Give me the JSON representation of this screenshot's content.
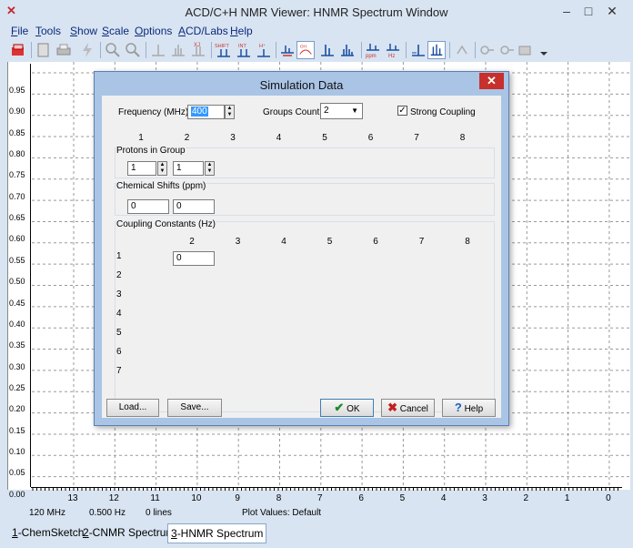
{
  "window": {
    "title": "ACD/C+H NMR Viewer: HNMR Spectrum Window",
    "icon": "acd-app-icon"
  },
  "menu": [
    {
      "key": "F",
      "rest": "ile"
    },
    {
      "key": "T",
      "rest": "ools"
    },
    {
      "key": "S",
      "rest": "how"
    },
    {
      "key": "S",
      "rest": "cale"
    },
    {
      "key": "O",
      "rest": "ptions"
    },
    {
      "key": "A",
      "rest": "CD/Labs"
    },
    {
      "key": "H",
      "rest": "elp"
    }
  ],
  "toolbar": {
    "shift_label": "SHIFT",
    "int_label": "INT",
    "ppm_label": "ppm",
    "hz_label": "Hz",
    "oh_label": "OH"
  },
  "plot": {
    "y_ticks": [
      "0.95",
      "0.90",
      "0.85",
      "0.80",
      "0.75",
      "0.70",
      "0.65",
      "0.60",
      "0.55",
      "0.50",
      "0.45",
      "0.40",
      "0.35",
      "0.30",
      "0.25",
      "0.20",
      "0.15",
      "0.10",
      "0.05",
      "0.00"
    ],
    "x_ticks": [
      "13",
      "12",
      "11",
      "10",
      "9",
      "8",
      "7",
      "6",
      "5",
      "4",
      "3",
      "2",
      "1",
      "0"
    ]
  },
  "status": {
    "freq": "120 MHz",
    "hz": "0.500 Hz",
    "lines": "0 lines",
    "plot_values": "Plot Values: Default"
  },
  "tabs": [
    {
      "key": "1",
      "label": "-ChemSketch",
      "active": false
    },
    {
      "key": "2",
      "label": "-CNMR Spectrum",
      "active": false
    },
    {
      "key": "3",
      "label": "-HNMR Spectrum",
      "active": true
    }
  ],
  "dialog": {
    "title": "Simulation Data",
    "frequency_label": "Frequency (MHz) :",
    "frequency_value": "400",
    "groups_label": "Groups Count :",
    "groups_value": "2",
    "strong_coupling_label": "Strong Coupling",
    "strong_coupling_checked": true,
    "columns": [
      "1",
      "2",
      "3",
      "4",
      "5",
      "6",
      "7",
      "8"
    ],
    "protons_label": "Protons in Group",
    "protons": [
      "1",
      "1"
    ],
    "shifts_label": "Chemical Shifts (ppm)",
    "shifts": [
      "0",
      "0"
    ],
    "coupling_label": "Coupling Constants (Hz)",
    "coupling_columns": [
      "2",
      "3",
      "4",
      "5",
      "6",
      "7",
      "8"
    ],
    "coupling_rows": [
      "1",
      "2",
      "3",
      "4",
      "5",
      "6",
      "7"
    ],
    "coupling_value": "0",
    "buttons": {
      "load": "Load...",
      "save": "Save...",
      "ok": "OK",
      "cancel": "Cancel",
      "help": "Help"
    }
  }
}
